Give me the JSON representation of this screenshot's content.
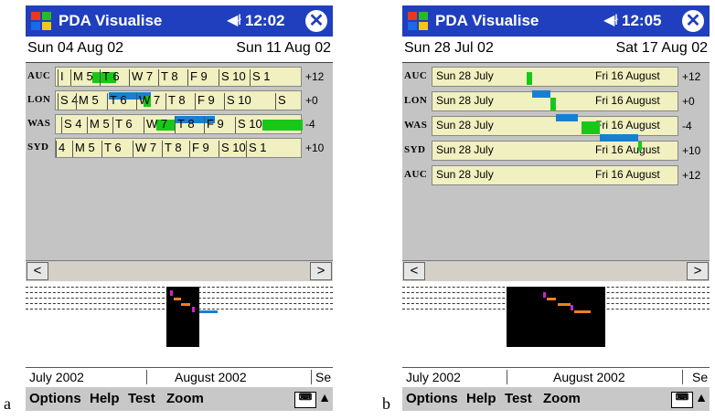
{
  "panel_a": {
    "caption": "a",
    "app_title": "PDA Visualise",
    "time": "12:02",
    "date_start": "Sun 04 Aug 02",
    "date_end": "Sun 11 Aug 02",
    "rows": [
      {
        "city": "AUC",
        "offset": "+12",
        "cells": [
          "I",
          "M 5",
          "T 6",
          "W 7",
          "T 8",
          "F 9",
          "S 10",
          "S 1"
        ]
      },
      {
        "city": "LON",
        "offset": "+0",
        "cells": [
          "S 4",
          "M 5",
          "T 6",
          "W 7",
          "T 8",
          "F 9",
          "S 10",
          "S"
        ]
      },
      {
        "city": "WAS",
        "offset": "-4",
        "cells": [
          "S 4",
          "M 5",
          "T 6",
          "W 7",
          "T 8",
          "F 9",
          "S 10"
        ]
      },
      {
        "city": "SYD",
        "offset": "+10",
        "cells": [
          "4",
          "M 5",
          "T 6",
          "W 7",
          "T 8",
          "F 9",
          "S 10",
          "S 1"
        ]
      }
    ],
    "months": [
      "July 2002",
      "August 2002",
      "Se"
    ]
  },
  "panel_b": {
    "caption": "b",
    "app_title": "PDA Visualise",
    "time": "12:05",
    "date_start": "Sun 28 Jul 02",
    "date_end": "Sat 17 Aug 02",
    "rows": [
      {
        "city": "AUC",
        "offset": "+12",
        "start": "Sun 28 July",
        "end": "Fri 16 August"
      },
      {
        "city": "LON",
        "offset": "+0",
        "start": "Sun 28 July",
        "end": "Fri 16 August"
      },
      {
        "city": "WAS",
        "offset": "-4",
        "start": "Sun 28 July",
        "end": "Fri 16 August"
      },
      {
        "city": "SYD",
        "offset": "+10",
        "start": "Sun 28 July",
        "end": "Fri 16 August"
      },
      {
        "city": "AUC",
        "offset": "+12",
        "start": "Sun 28 July",
        "end": "Fri 16 August"
      }
    ],
    "months": [
      "July 2002",
      "August 2002",
      "Se"
    ]
  },
  "menu": {
    "options": "Options",
    "help": "Help",
    "test": "Test",
    "zoom": "Zoom"
  },
  "scroll": {
    "left": "<",
    "right": ">"
  },
  "icons": {
    "speaker": "speaker-icon",
    "close": "close-icon",
    "keyboard": "keyboard-icon",
    "windows": "windows-logo-icon"
  },
  "colors": {
    "title_bar": "#1f3fbf",
    "row_bg": "#f0f0c0",
    "green": "#18c818",
    "blue": "#1880d0",
    "grid_bg": "#c4c4c4"
  }
}
